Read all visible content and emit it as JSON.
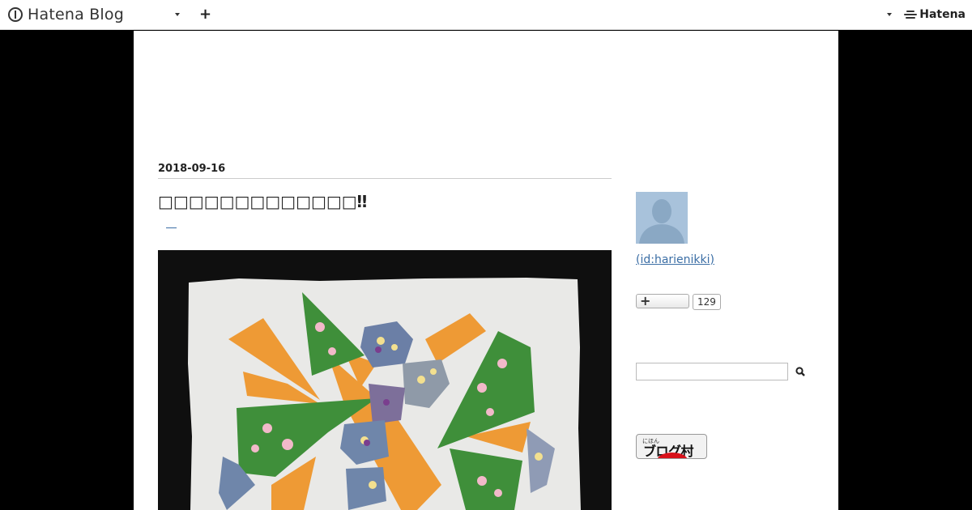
{
  "topbar": {
    "logo_text": "Hatena Blog",
    "brand_right": "Hatena"
  },
  "post": {
    "date": "2018-09-16",
    "title": "□□□□□□□□□□□□□‼"
  },
  "sidebar": {
    "profile_id": " (id:harienikki)",
    "star_count": "129"
  },
  "blogmura": {
    "small_label": "にほん",
    "label": "ブログ村"
  },
  "icons": [
    "hatena-blog-logo-icon",
    "chevron-down-icon",
    "plus-icon",
    "hatena-logo-icon",
    "search-icon"
  ]
}
